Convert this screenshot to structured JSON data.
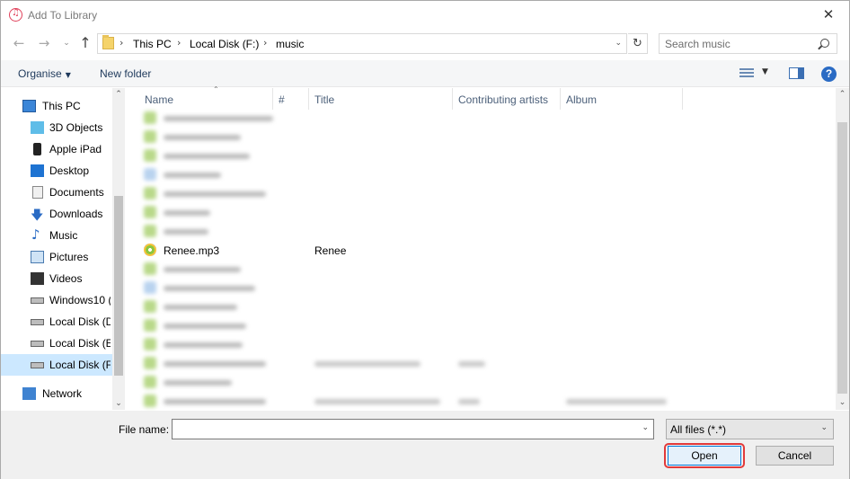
{
  "window": {
    "title": "Add To Library",
    "close_glyph": "✕"
  },
  "address_bar": {
    "segments": [
      "This PC",
      "Local Disk (F:)",
      "music"
    ]
  },
  "search": {
    "placeholder": "Search music"
  },
  "toolbar": {
    "organise_label": "Organise",
    "new_folder_label": "New folder",
    "help_label": "?"
  },
  "sidebar": {
    "items": [
      {
        "label": "This PC",
        "icon": "computer-icon"
      },
      {
        "label": "3D Objects",
        "icon": "cube-icon"
      },
      {
        "label": "Apple iPad",
        "icon": "ipad-icon"
      },
      {
        "label": "Desktop",
        "icon": "desktop-icon"
      },
      {
        "label": "Documents",
        "icon": "documents-icon"
      },
      {
        "label": "Downloads",
        "icon": "download-icon"
      },
      {
        "label": "Music",
        "icon": "music-note-icon"
      },
      {
        "label": "Pictures",
        "icon": "pictures-icon"
      },
      {
        "label": "Videos",
        "icon": "videos-icon"
      },
      {
        "label": "Windows10 (",
        "icon": "drive-icon"
      },
      {
        "label": "Local Disk (D",
        "icon": "drive-icon"
      },
      {
        "label": "Local Disk (E:",
        "icon": "drive-icon"
      },
      {
        "label": "Local Disk (F:",
        "icon": "drive-icon",
        "selected": true
      },
      {
        "label": "Network",
        "icon": "network-icon"
      }
    ]
  },
  "file_list": {
    "columns": [
      "Name",
      "#",
      "Title",
      "Contributing artists",
      "Album"
    ],
    "visible_file": {
      "name": "Renee.mp3",
      "title": "Renee"
    }
  },
  "bottom": {
    "file_name_label": "File name:",
    "file_name_value": "",
    "filter_value": "All files (*.*)",
    "open_label": "Open",
    "cancel_label": "Cancel"
  },
  "colors": {
    "accent": "#0078d7",
    "selection": "#cce8ff",
    "highlight_outline": "#e23a3a"
  }
}
